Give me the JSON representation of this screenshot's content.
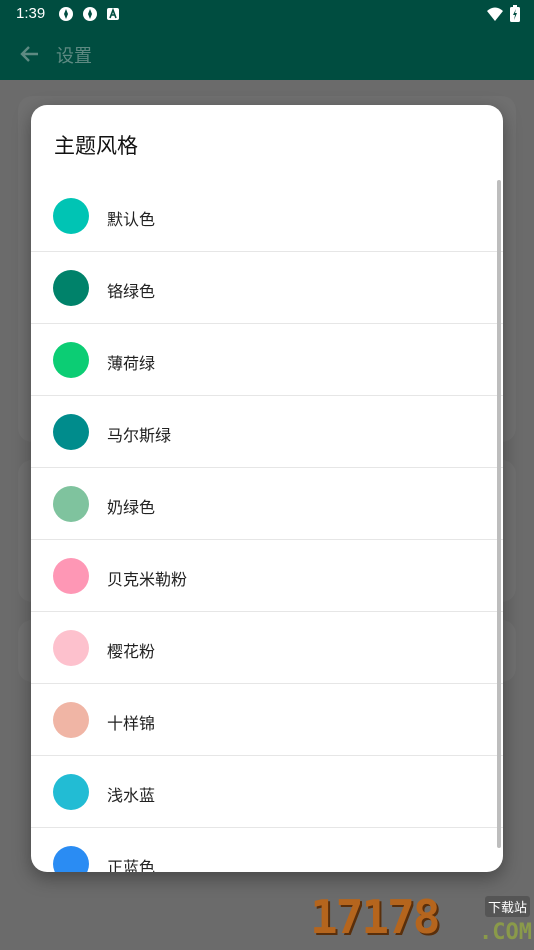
{
  "status_bar": {
    "time": "1:39"
  },
  "app_bar": {
    "title": "设置"
  },
  "dialog": {
    "title": "主题风格",
    "items": [
      {
        "label": "默认色",
        "color": "#00c4b4"
      },
      {
        "label": "铬绿色",
        "color": "#00826a"
      },
      {
        "label": "薄荷绿",
        "color": "#0ccd74"
      },
      {
        "label": "马尔斯绿",
        "color": "#008c8c"
      },
      {
        "label": "奶绿色",
        "color": "#7fc39e"
      },
      {
        "label": "贝克米勒粉",
        "color": "#fe97b5"
      },
      {
        "label": "樱花粉",
        "color": "#fdc1cd"
      },
      {
        "label": "十样锦",
        "color": "#f0b5a5"
      },
      {
        "label": "浅水蓝",
        "color": "#22bcd4"
      },
      {
        "label": "正蓝色",
        "color": "#2a8cf3"
      }
    ]
  },
  "watermark": {
    "number": "17178",
    "badge": "下载站",
    "domain": ".COM"
  }
}
